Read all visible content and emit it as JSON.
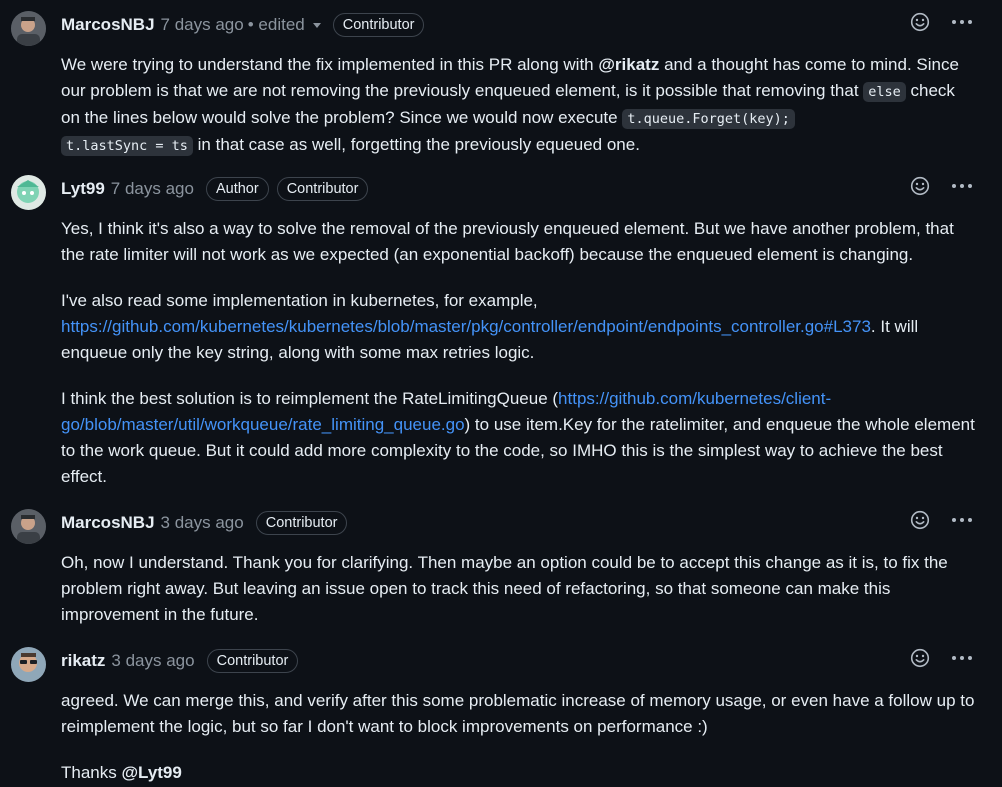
{
  "comments": [
    {
      "author": "MarcosNBJ",
      "time": "7 days ago",
      "edited": "• edited",
      "badges": [
        "Contributor"
      ],
      "body": {
        "t1": "We were trying to understand the fix implemented in this PR along with ",
        "mention": "@rikatz",
        "t2": " and a thought has come to mind. Since our problem is that we are not removing the previously enqueued element, is it possible that removing that ",
        "code1": "else",
        "t3": " check on the lines below would solve the problem? Since we would now execute ",
        "code2": "t.queue.Forget(key);",
        "code3": "t.lastSync = ts",
        "t4": " in that case as well, forgetting the previously equeued one."
      }
    },
    {
      "author": "Lyt99",
      "time": "7 days ago",
      "badges": [
        "Author",
        "Contributor"
      ],
      "body": {
        "p1": "Yes, I think it's also a way to solve the removal of the previously enqueued element. But we have another problem, that the rate limiter will not work as we expected (an exponential backoff) because the enqueued element is changing.",
        "p2a": "I've also read some implementation in kubernetes, for example,",
        "p2link": "https://github.com/kubernetes/kubernetes/blob/master/pkg/controller/endpoint/endpoints_controller.go#L373",
        "p2b": ". It will enqueue only the key string, along with some max retries logic.",
        "p3a": "I think the best solution is to reimplement the RateLimitingQueue (",
        "p3link1": "https://github.com/kubernetes/client-",
        "p3link2": "go/blob/master/util/workqueue/rate_limiting_queue.go",
        "p3b": ") to use item.Key for the ratelimiter, and enqueue the whole element to the work queue. But it could add more complexity to the code, so IMHO this is the simplest way to achieve the best effect."
      }
    },
    {
      "author": "MarcosNBJ",
      "time": "3 days ago",
      "badges": [
        "Contributor"
      ],
      "body": {
        "p1": "Oh, now I understand. Thank you for clarifying. Then maybe an option could be to accept this change as it is, to fix the problem right away. But leaving an issue open to track this need of refactoring, so that someone can make this improvement in the future."
      }
    },
    {
      "author": "rikatz",
      "time": "3 days ago",
      "badges": [
        "Contributor"
      ],
      "body": {
        "p1": "agreed. We can merge this, and verify after this some problematic increase of memory usage, or even have a follow up to reimplement the logic, but so far I don't want to block improvements on performance :)",
        "p2a": "Thanks ",
        "mention": "@Lyt99"
      }
    }
  ],
  "icons": {
    "reaction": "smiley-icon",
    "menu": "kebab-menu-icon"
  },
  "colors": {
    "background": "#0d1117",
    "link": "#4493f8",
    "muted": "#8b949e",
    "border": "#3d444d"
  }
}
